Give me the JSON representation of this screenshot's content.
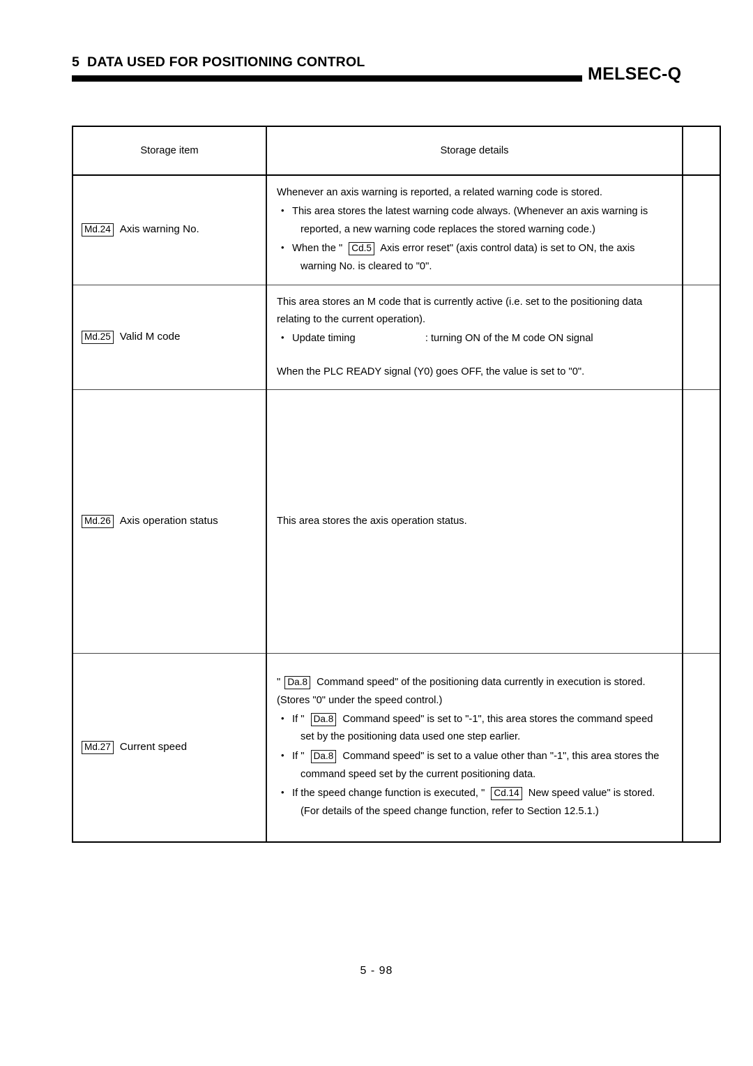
{
  "header": {
    "chapter_number": "5",
    "chapter_title": "DATA USED FOR POSITIONING CONTROL",
    "brand": "MELSEC-Q"
  },
  "table": {
    "columns": [
      {
        "key": "storage_item",
        "label": "Storage item"
      },
      {
        "key": "storage_details",
        "label": "Storage details"
      },
      {
        "key": "extra",
        "label": ""
      }
    ],
    "rows": [
      {
        "code": "Md.24",
        "item": "Axis warning No.",
        "intro": "Whenever an axis warning is reported, a related warning code is stored.",
        "bullets": [
          {
            "line1": "This area stores the latest warning code always.  (Whenever an axis warning is",
            "line2": "reported, a new warning code replaces the stored warning code.)"
          },
          {
            "pre": "When the \"",
            "badge": "Cd.5",
            "post": "Axis error reset\" (axis control data) is set to ON, the axis",
            "line2": "warning No. is cleared to \"0\"."
          }
        ]
      },
      {
        "code": "Md.25",
        "item": "Valid M code",
        "intro_line1": "This area stores an M code that is currently active (i.e. set to the positioning data",
        "intro_line2": "relating to the current operation).",
        "bullet_label": "Update timing",
        "bullet_value": ": turning ON of the M code ON signal",
        "outro": "When the PLC READY signal (Y0) goes OFF, the value is set to \"0\"."
      },
      {
        "code": "Md.26",
        "item": "Axis operation status",
        "detail": "This area stores the axis operation status."
      },
      {
        "code": "Md.27",
        "item": "Current speed",
        "intro_pre": "\"",
        "intro_badge": "Da.8",
        "intro_post": "Command speed\" of the positioning data currently in execution is stored.",
        "intro_line2": "(Stores \"0\" under the speed control.)",
        "bullets": [
          {
            "pre": "If \"",
            "badge": "Da.8",
            "post": "Command speed\" is set to \"-1\", this area stores the command speed",
            "line2": "set by the positioning data used one step earlier."
          },
          {
            "pre": "If \"",
            "badge": "Da.8",
            "post": "Command speed\" is set to a value other than \"-1\", this area stores the",
            "line2": "command speed set by the current positioning data."
          },
          {
            "pre": "If the speed change function is executed, \"",
            "badge": "Cd.14",
            "post": "New speed value\" is stored.",
            "line2": "(For details of the speed change function, refer to Section 12.5.1.)"
          }
        ]
      }
    ]
  },
  "footer": {
    "page_label": "5 - 98"
  }
}
